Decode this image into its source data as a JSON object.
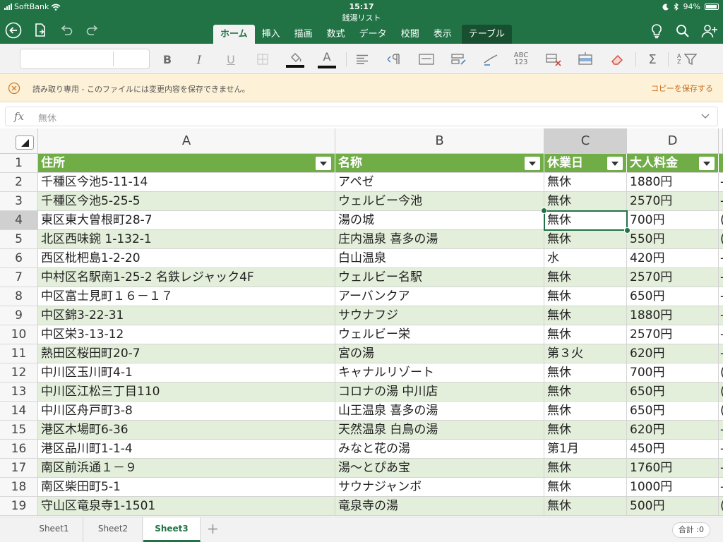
{
  "status": {
    "carrier": "SoftBank",
    "time": "15:17",
    "battery": "94%"
  },
  "document": {
    "title": "銭湯リスト"
  },
  "tabs": [
    {
      "label": "ホーム",
      "active": true
    },
    {
      "label": "挿入"
    },
    {
      "label": "描画"
    },
    {
      "label": "数式"
    },
    {
      "label": "データ"
    },
    {
      "label": "校閲"
    },
    {
      "label": "表示"
    },
    {
      "label": "テーブル",
      "contextual": true
    }
  ],
  "toolbar": {
    "bold": "B",
    "italic": "I",
    "underline": "U",
    "font_color": "A",
    "number_format": "ABC\n123",
    "sum": "Σ",
    "sort": "A Z"
  },
  "notice": {
    "message": "読み取り専用 - このファイルには変更内容を保存できません。",
    "action": "コピーを保存する"
  },
  "formula_bar": {
    "label": "fx",
    "value": "無休"
  },
  "grid": {
    "columns": [
      "A",
      "B",
      "C",
      "D"
    ],
    "header": [
      "住所",
      "名称",
      "休業日",
      "大人料金"
    ],
    "rows": [
      {
        "n": "1"
      },
      {
        "n": "2",
        "cells": [
          "千種区今池5-11-14",
          "アペゼ",
          "無休",
          "1880円"
        ],
        "e": "-"
      },
      {
        "n": "3",
        "cells": [
          "千種区今池5-25-5",
          "ウェルビー今池",
          "無休",
          "2570円"
        ],
        "e": "-"
      },
      {
        "n": "4",
        "cells": [
          "東区東大曽根町28-7",
          "湯の城",
          "無休",
          "700円"
        ],
        "e": "("
      },
      {
        "n": "5",
        "cells": [
          "北区西味鋺 1-132-1",
          "庄内温泉 喜多の湯",
          "無休",
          "550円"
        ],
        "e": "("
      },
      {
        "n": "6",
        "cells": [
          "西区枇杷島1-2-20",
          "白山温泉",
          "水",
          "420円"
        ],
        "e": "-"
      },
      {
        "n": "7",
        "cells": [
          "中村区名駅南1-25-2 名鉄レジャック4F",
          "ウェルビー名駅",
          "無休",
          "2570円"
        ],
        "e": "-"
      },
      {
        "n": "8",
        "cells": [
          "中区富士見町１６－１７",
          "アーバンクア",
          "無休",
          "650円"
        ],
        "e": "-"
      },
      {
        "n": "9",
        "cells": [
          "中区錦3-22-31",
          "サウナフジ",
          "無休",
          "1880円"
        ],
        "e": "-"
      },
      {
        "n": "10",
        "cells": [
          "中区栄3-13-12",
          "ウェルビー栄",
          "無休",
          "2570円"
        ],
        "e": "-"
      },
      {
        "n": "11",
        "cells": [
          "熱田区桜田町20-7",
          "宮の湯",
          "第３火",
          "620円"
        ],
        "e": "-"
      },
      {
        "n": "12",
        "cells": [
          "中川区玉川町4-1",
          "キャナルリゾート",
          "無休",
          "700円"
        ],
        "e": "("
      },
      {
        "n": "13",
        "cells": [
          "中川区江松三丁目110",
          "コロナの湯 中川店",
          "無休",
          "650円"
        ],
        "e": "("
      },
      {
        "n": "14",
        "cells": [
          "中川区舟戸町3-8",
          "山王温泉 喜多の湯",
          "無休",
          "650円"
        ],
        "e": "("
      },
      {
        "n": "15",
        "cells": [
          "港区木場町6-36",
          "天然温泉 白鳥の湯",
          "無休",
          "620円"
        ],
        "e": "-"
      },
      {
        "n": "16",
        "cells": [
          "港区品川町1-1-4",
          "みなと花の湯",
          "第1月",
          "450円"
        ],
        "e": "-"
      },
      {
        "n": "17",
        "cells": [
          "南区前浜通１－９",
          "湯～とぴあ宝",
          "無休",
          "1760円"
        ],
        "e": "-"
      },
      {
        "n": "18",
        "cells": [
          "南区柴田町5-1",
          "サウナジャンボ",
          "無休",
          "1000円"
        ],
        "e": "-"
      },
      {
        "n": "19",
        "cells": [
          "守山区竜泉寺1-1501",
          "竜泉寺の湯",
          "無休",
          "500円"
        ],
        "e": "("
      }
    ]
  },
  "sheets": [
    {
      "label": "Sheet1"
    },
    {
      "label": "Sheet2"
    },
    {
      "label": "Sheet3",
      "active": true
    }
  ],
  "add_sheet": "+",
  "sum_pill": "合計 :0"
}
